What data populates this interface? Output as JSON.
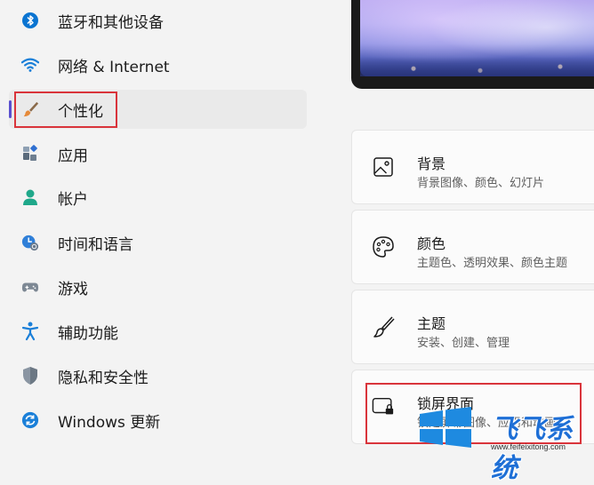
{
  "sidebar": {
    "items": [
      {
        "label": "蓝牙和其他设备",
        "icon": "bluetooth-icon"
      },
      {
        "label": "网络 & Internet",
        "icon": "wifi-icon"
      },
      {
        "label": "个性化",
        "icon": "brush-icon",
        "selected": true
      },
      {
        "label": "应用",
        "icon": "apps-icon"
      },
      {
        "label": "帐户",
        "icon": "account-icon"
      },
      {
        "label": "时间和语言",
        "icon": "time-language-icon"
      },
      {
        "label": "游戏",
        "icon": "gamepad-icon"
      },
      {
        "label": "辅助功能",
        "icon": "accessibility-icon"
      },
      {
        "label": "隐私和安全性",
        "icon": "shield-icon"
      },
      {
        "label": "Windows 更新",
        "icon": "update-icon"
      }
    ]
  },
  "cards": [
    {
      "title": "背景",
      "subtitle": "背景图像、颜色、幻灯片",
      "icon": "picture-icon"
    },
    {
      "title": "颜色",
      "subtitle": "主题色、透明效果、颜色主题",
      "icon": "palette-icon"
    },
    {
      "title": "主题",
      "subtitle": "安装、创建、管理",
      "icon": "theme-brush-icon"
    },
    {
      "title": "锁屏界面",
      "subtitle": "锁定屏幕图像、应用和动画",
      "icon": "lock-screen-icon"
    }
  ],
  "watermark": {
    "brand": "飞飞系统",
    "url": "www.feifeixitong.com"
  },
  "colors": {
    "accent": "#5a4fcf",
    "highlight_box": "#d9343b",
    "watermark_blue": "#1e6fd6"
  }
}
